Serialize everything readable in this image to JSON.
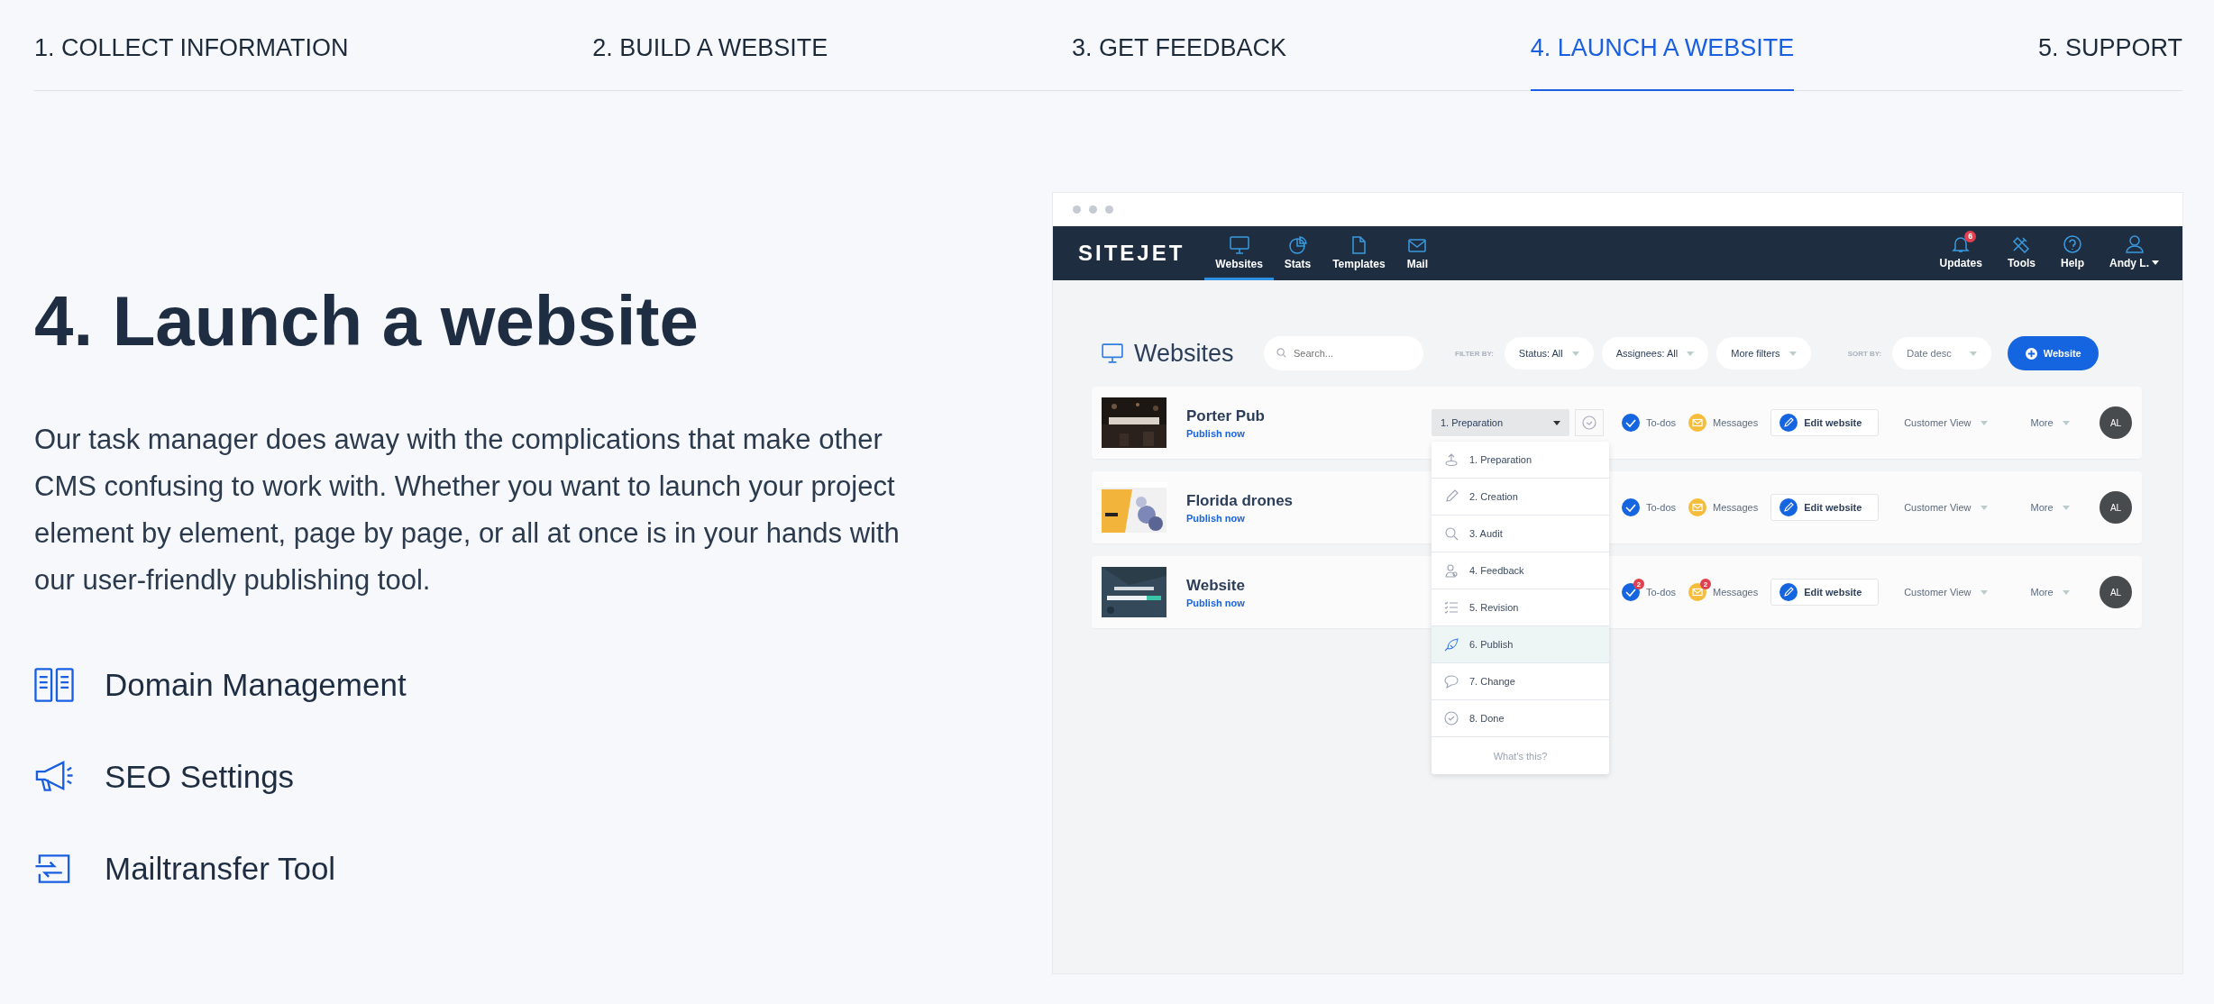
{
  "steps": [
    {
      "label": "1. COLLECT INFORMATION",
      "selected": false
    },
    {
      "label": "2. BUILD A WEBSITE",
      "selected": false
    },
    {
      "label": "3. GET FEEDBACK",
      "selected": false
    },
    {
      "label": "4. LAUNCH A WEBSITE",
      "selected": true
    },
    {
      "label": "5. SUPPORT",
      "selected": false
    }
  ],
  "heading": "4. Launch a website",
  "intro": "Our task manager does away with the complications that make other CMS confusing to work with. Whether you want to launch your project element by element, page by page, or all at once is in your hands with our user-friendly publishing tool.",
  "features": [
    {
      "label": "Domain Management"
    },
    {
      "label": "SEO Settings"
    },
    {
      "label": "Mailtransfer Tool"
    }
  ],
  "app": {
    "logo": "SITEJET",
    "nav": [
      {
        "label": "Websites",
        "selected": true
      },
      {
        "label": "Stats",
        "selected": false
      },
      {
        "label": "Templates",
        "selected": false
      },
      {
        "label": "Mail",
        "selected": false
      }
    ],
    "nav_right": [
      {
        "label": "Updates",
        "badge": "6"
      },
      {
        "label": "Tools"
      },
      {
        "label": "Help"
      },
      {
        "label": "Andy L."
      }
    ],
    "page_title": "Websites",
    "search": {
      "placeholder": "Search..."
    },
    "filter_label": "FILTER BY:",
    "filters": [
      "Status: All",
      "Assignees: All",
      "More filters"
    ],
    "sort_label": "SORT BY:",
    "sort": "Date desc",
    "add_button": "Website",
    "sites": [
      {
        "name": "Porter Pub",
        "action": "Publish now",
        "status": "1. Preparation",
        "todos": "To-dos",
        "messages": "Messages",
        "edit": "Edit website",
        "view": "Customer View",
        "more": "More",
        "avatar": "AL"
      },
      {
        "name": "Florida drones",
        "action": "Publish now",
        "todos": "To-dos",
        "messages": "Messages",
        "edit": "Edit website",
        "view": "Customer View",
        "more": "More",
        "avatar": "AL"
      },
      {
        "name": "Website",
        "action": "Publish now",
        "todos": "To-dos",
        "todos_badge": "2",
        "messages": "Messages",
        "messages_badge": "2",
        "edit": "Edit website",
        "view": "Customer View",
        "more": "More",
        "avatar": "AL"
      }
    ],
    "status_menu": {
      "items": [
        {
          "label": "1. Preparation",
          "selected": false
        },
        {
          "label": "2. Creation",
          "selected": false
        },
        {
          "label": "3. Audit",
          "selected": false
        },
        {
          "label": "4. Feedback",
          "selected": false
        },
        {
          "label": "5. Revision",
          "selected": false
        },
        {
          "label": "6. Publish",
          "selected": true
        },
        {
          "label": "7. Change",
          "selected": false
        },
        {
          "label": "8. Done",
          "selected": false
        }
      ],
      "help": "What's this?"
    }
  }
}
